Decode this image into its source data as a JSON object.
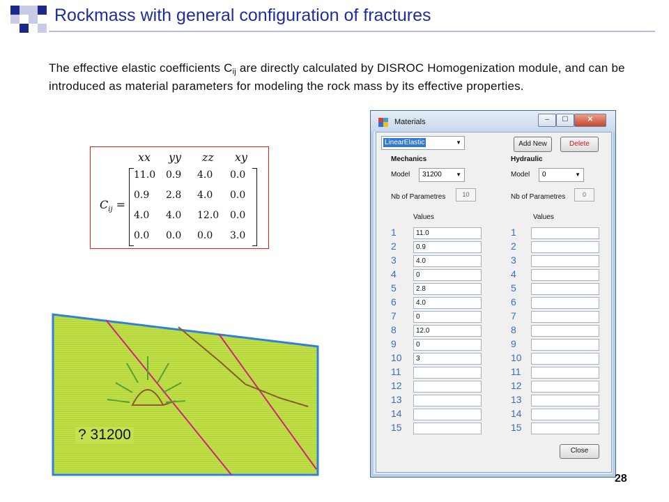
{
  "slide": {
    "title": "Rockmass with general configuration of fractures",
    "paragraph_pre": "The effective elastic coefficients C",
    "paragraph_sub": "ij",
    "paragraph_post": " are directly calculated by  DISROC Homogenization module, and can be introduced as material parameters for modeling the rock mass by its effective properties.",
    "page_number": "28"
  },
  "matrix": {
    "headers": [
      "xx",
      "yy",
      "zz",
      "xy"
    ],
    "label": "C",
    "label_sub": "ij",
    "label_eq": " =",
    "rows": [
      [
        "11.0",
        "0.9",
        "4.0",
        "0.0"
      ],
      [
        "0.9",
        "2.8",
        "4.0",
        "0.0"
      ],
      [
        "4.0",
        "4.0",
        "12.0",
        "0.0"
      ],
      [
        "0.0",
        "0.0",
        "0.0",
        "3.0"
      ]
    ]
  },
  "sketch": {
    "label": "? 31200",
    "colors": {
      "fill": "#c5e24e",
      "border": "#2f80d8",
      "fracture": "#d0207a",
      "trace": "#8a5a2a"
    }
  },
  "window": {
    "title": "Materials",
    "buttons": {
      "minimize": "–",
      "maximize": "☐",
      "close": "✕"
    },
    "material_type": "LinearElastic",
    "add_new": "Add New",
    "delete": "Delete",
    "close": "Close",
    "mechanics": {
      "header": "Mechanics",
      "model_label": "Model",
      "model_value": "31200",
      "nb_label": "Nb of Parametres",
      "nb_value": "10",
      "values_header": "Values",
      "values": [
        "11.0",
        "0.9",
        "4.0",
        "0",
        "2.8",
        "4.0",
        "0",
        "12.0",
        "0",
        "3",
        "",
        "",
        "",
        "",
        ""
      ]
    },
    "hydraulic": {
      "header": "Hydraulic",
      "model_label": "Model",
      "model_value": "0",
      "nb_label": "Nb of Parametres",
      "nb_value": "0",
      "values_header": "Values",
      "values": [
        "",
        "",
        "",
        "",
        "",
        "",
        "",
        "",
        "",
        "",
        "",
        "",
        "",
        "",
        ""
      ]
    },
    "row_numbers": [
      "1",
      "2",
      "3",
      "4",
      "5",
      "6",
      "7",
      "8",
      "9",
      "10",
      "11",
      "12",
      "13",
      "14",
      "15"
    ]
  }
}
